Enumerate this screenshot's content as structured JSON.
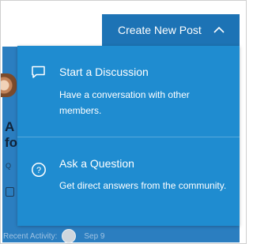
{
  "header": {
    "create_post_label": "Create New Post"
  },
  "menu": {
    "items": [
      {
        "label": "Start a Discussion",
        "description": "Have a conversation with other members.",
        "icon": "chat-bubble-icon"
      },
      {
        "label": "Ask a Question",
        "description": "Get direct answers from the community.",
        "icon": "question-circle-icon"
      }
    ]
  },
  "background": {
    "title_fragment": "A fo",
    "meta_fragment": "Q",
    "recent_activity_label": "Recent Activity:",
    "recent_activity_date": "Sep 9"
  },
  "colors": {
    "menu_bg": "#1f8cd0",
    "button_bg": "#1d73b5",
    "card_bg": "#2b7ec0"
  }
}
